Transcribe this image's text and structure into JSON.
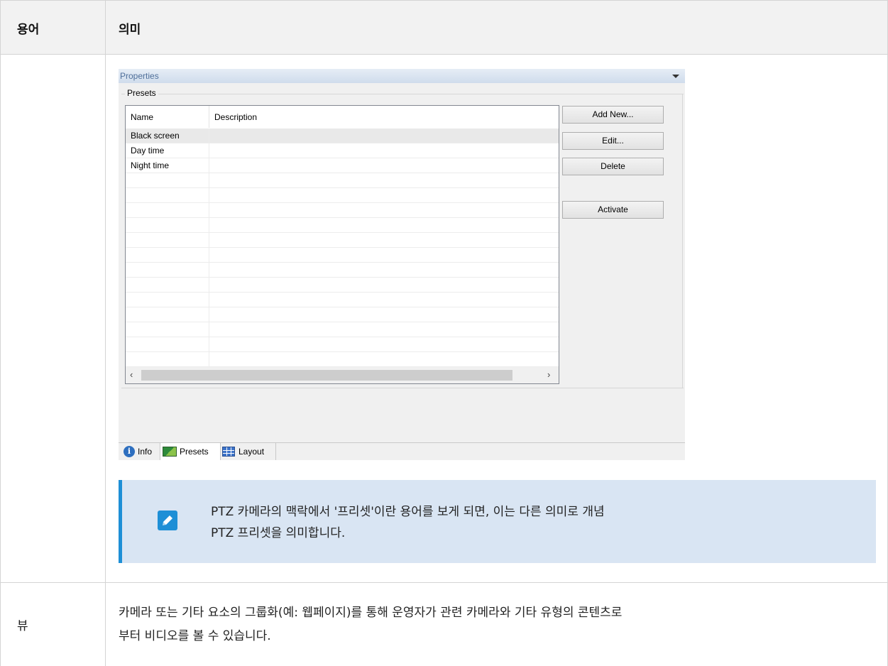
{
  "table": {
    "header_term": "용어",
    "header_meaning": "의미",
    "row_view_term": "뷰",
    "row_view_line1": "카메라 또는 기타 요소의 그룹화(예: 웹페이지)를 통해 운영자가 관련 카메라와 기타 유형의 콘텐츠로",
    "row_view_line2": "부터 비디오를 볼 수 있습니다."
  },
  "panel": {
    "title": "Properties",
    "group_label": "Presets",
    "columns": [
      "Name",
      "Description"
    ],
    "presets": [
      "Black screen",
      "Day time",
      "Night time"
    ],
    "buttons": {
      "add_new": "Add New...",
      "edit": "Edit...",
      "delete": "Delete",
      "activate": "Activate"
    },
    "tabs": [
      "Info",
      "Presets",
      "Layout"
    ]
  },
  "note": {
    "line1": "PTZ 카메라의 맥락에서 '프리셋'이란 용어를 보게 되면, 이는 다른 의미로 개념",
    "line2": "PTZ 프리셋을 의미합니다."
  }
}
